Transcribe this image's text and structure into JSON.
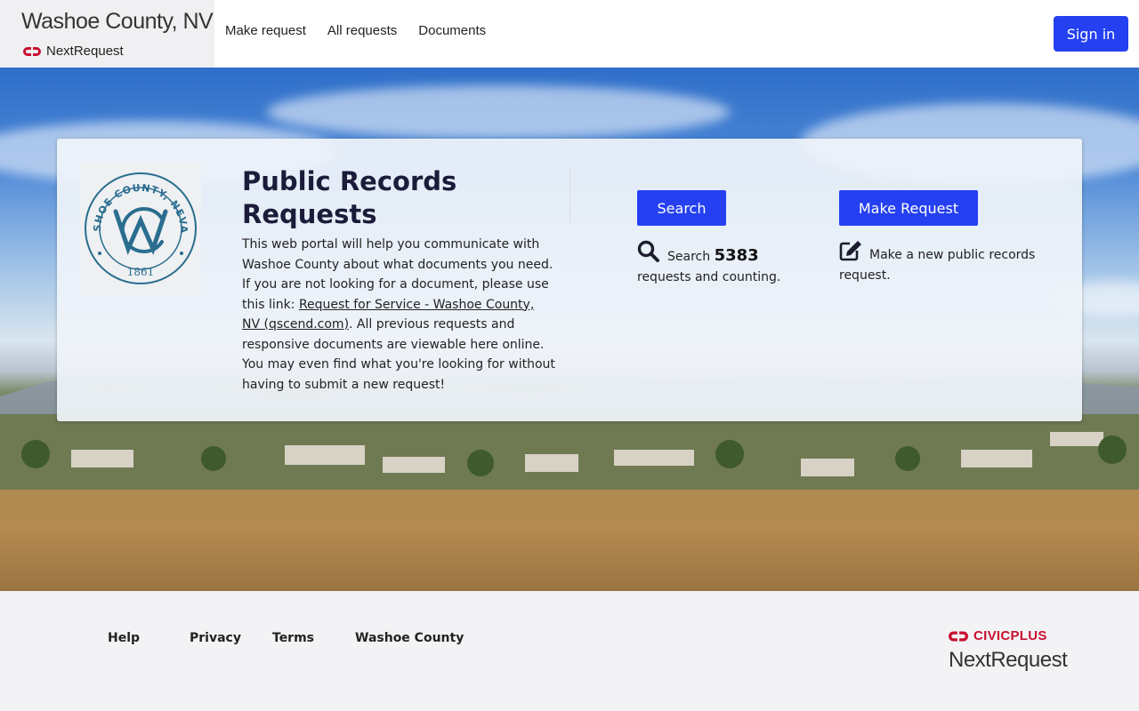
{
  "header": {
    "site_title": "Washoe County, NV",
    "brand_name": "NextRequest",
    "nav": [
      "Make request",
      "All requests",
      "Documents"
    ],
    "sign_in_label": "Sign in"
  },
  "seal": {
    "top_text": "WASHOE COUNTY, NEVADA",
    "year": "1861"
  },
  "hero": {
    "title": "Public Records Requests",
    "intro_before_link": "This web portal will help you communicate with Washoe County about what documents you need. If you are not looking for a document, please use this link: ",
    "link_text": "Request for Service - Washoe County, NV (qscend.com)",
    "intro_after_link": ". All previous requests and responsive documents are viewable here online. You may even find what you're looking for without having to submit a new request!",
    "search_button": "Search",
    "search_prefix": "Search",
    "request_count": "5383",
    "search_suffix": "requests and counting.",
    "make_request_button": "Make Request",
    "make_request_text": "Make a new public records request."
  },
  "footer": {
    "links": [
      "Help",
      "Privacy",
      "Terms",
      "Washoe County"
    ],
    "civicplus_label": "CIVICPLUS",
    "nextrequest_label": "NextRequest"
  },
  "colors": {
    "accent": "#2440f0",
    "civicplus_red": "#c8102e"
  }
}
